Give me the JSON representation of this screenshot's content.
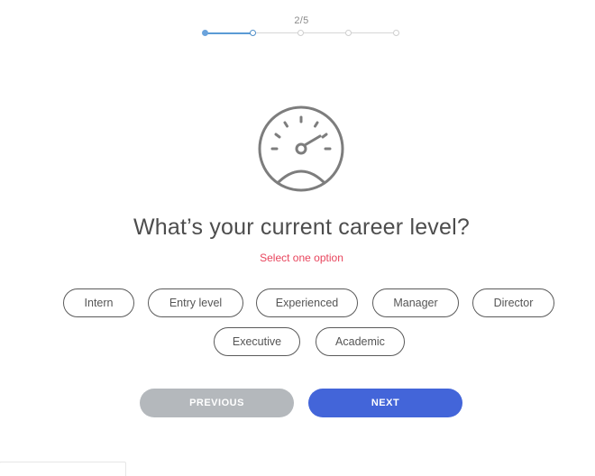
{
  "stepper": {
    "counter": "2/5",
    "current_step": 2,
    "total_steps": 5,
    "accent_color": "#6aa3dc"
  },
  "icon": "speedometer-icon",
  "question": {
    "title": "What’s your current career level?",
    "hint": "Select one option",
    "hint_color": "#e8455d"
  },
  "options": [
    "Intern",
    "Entry level",
    "Experienced",
    "Manager",
    "Director",
    "Executive",
    "Academic"
  ],
  "buttons": {
    "previous": "PREVIOUS",
    "next": "NEXT",
    "next_color": "#4365d9",
    "previous_color": "#b4b8bc"
  }
}
